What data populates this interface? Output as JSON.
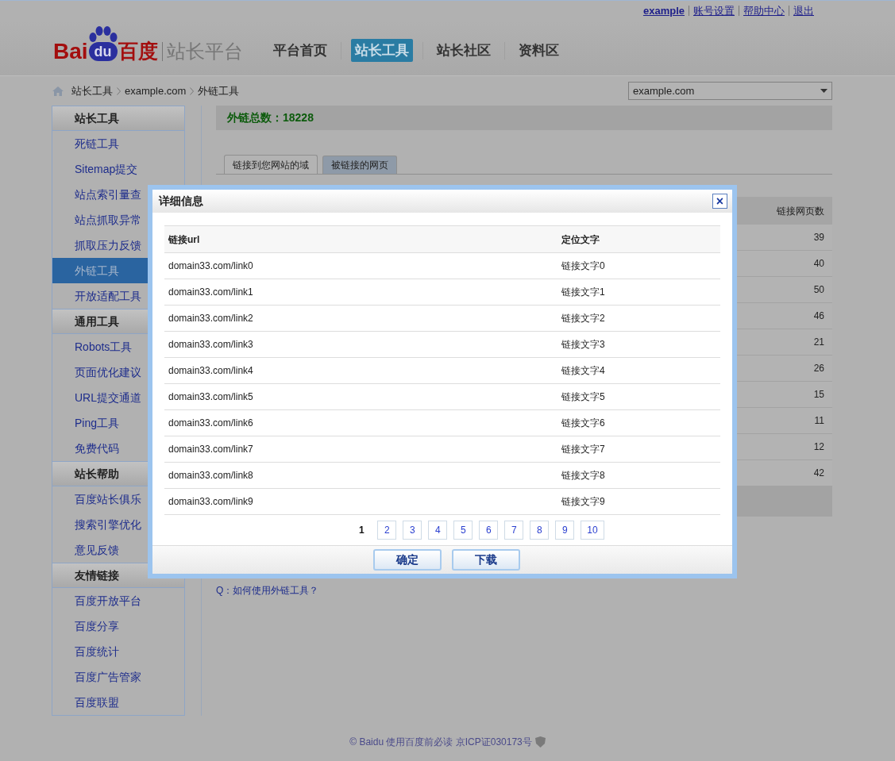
{
  "top_links": [
    {
      "label": "example",
      "bold": true
    },
    {
      "label": "账号设置",
      "bold": false
    },
    {
      "label": "帮助中心",
      "bold": false
    },
    {
      "label": "退出",
      "bold": false
    }
  ],
  "logo": {
    "brand": "Bai",
    "badge": "du",
    "name": "百度",
    "product": "站长平台"
  },
  "nav": [
    {
      "label": "平台首页",
      "selected": false
    },
    {
      "label": "站长工具",
      "selected": true
    },
    {
      "label": "站长社区",
      "selected": false
    },
    {
      "label": "资料区",
      "selected": false
    }
  ],
  "breadcrumb": [
    "站长工具",
    "example.com",
    "外链工具"
  ],
  "site_select": {
    "value": "example.com"
  },
  "sidebar": [
    {
      "title": "站长工具",
      "items": [
        {
          "label": "死链工具",
          "selected": false
        },
        {
          "label": "Sitemap提交",
          "selected": false
        },
        {
          "label": "站点索引量查",
          "selected": false
        },
        {
          "label": "站点抓取异常",
          "selected": false
        },
        {
          "label": "抓取压力反馈",
          "selected": false
        },
        {
          "label": "外链工具",
          "selected": true
        },
        {
          "label": "开放适配工具",
          "selected": false
        }
      ]
    },
    {
      "title": "通用工具",
      "items": [
        {
          "label": "Robots工具",
          "selected": false
        },
        {
          "label": "页面优化建议",
          "selected": false
        },
        {
          "label": "URL提交通道",
          "selected": false
        },
        {
          "label": "Ping工具",
          "selected": false
        },
        {
          "label": "免费代码",
          "selected": false
        }
      ]
    },
    {
      "title": "站长帮助",
      "items": [
        {
          "label": "百度站长俱乐",
          "selected": false
        },
        {
          "label": "搜索引擎优化",
          "selected": false
        },
        {
          "label": "意见反馈",
          "selected": false
        }
      ]
    },
    {
      "title": "友情链接",
      "items": [
        {
          "label": "百度开放平台",
          "selected": false
        },
        {
          "label": "百度分享",
          "selected": false
        },
        {
          "label": "百度统计",
          "selected": false
        },
        {
          "label": "百度广告管家",
          "selected": false
        },
        {
          "label": "百度联盟",
          "selected": false
        }
      ]
    }
  ],
  "total": "外链总数：18228",
  "tabs": [
    {
      "label": "链接到您网站的域",
      "selected": true
    },
    {
      "label": "被链接的网页",
      "selected": false
    }
  ],
  "table": {
    "columns": [
      "链接网页数"
    ],
    "rows": [
      "39",
      "40",
      "50",
      "46",
      "21",
      "26",
      "15",
      "11",
      "12",
      "42"
    ]
  },
  "faq": [
    "Q：如何使用外链工具？"
  ],
  "dialog": {
    "title": "详细信息",
    "close": "×",
    "columns": [
      "链接url",
      "定位文字"
    ],
    "rows": [
      {
        "url": "domain33.com/link0",
        "text": "链接文字0"
      },
      {
        "url": "domain33.com/link1",
        "text": "链接文字1"
      },
      {
        "url": "domain33.com/link2",
        "text": "链接文字2"
      },
      {
        "url": "domain33.com/link3",
        "text": "链接文字3"
      },
      {
        "url": "domain33.com/link4",
        "text": "链接文字4"
      },
      {
        "url": "domain33.com/link5",
        "text": "链接文字5"
      },
      {
        "url": "domain33.com/link6",
        "text": "链接文字6"
      },
      {
        "url": "domain33.com/link7",
        "text": "链接文字7"
      },
      {
        "url": "domain33.com/link8",
        "text": "链接文字8"
      },
      {
        "url": "domain33.com/link9",
        "text": "链接文字9"
      }
    ],
    "pages": [
      {
        "label": "1",
        "selected": true
      },
      {
        "label": "2",
        "selected": false
      },
      {
        "label": "3",
        "selected": false
      },
      {
        "label": "4",
        "selected": false
      },
      {
        "label": "5",
        "selected": false
      },
      {
        "label": "6",
        "selected": false
      },
      {
        "label": "7",
        "selected": false
      },
      {
        "label": "8",
        "selected": false
      },
      {
        "label": "9",
        "selected": false
      },
      {
        "label": "10",
        "selected": false
      }
    ],
    "buttons": [
      "确定",
      "下载"
    ]
  },
  "footer": "© Baidu 使用百度前必读 京ICP证030173号"
}
